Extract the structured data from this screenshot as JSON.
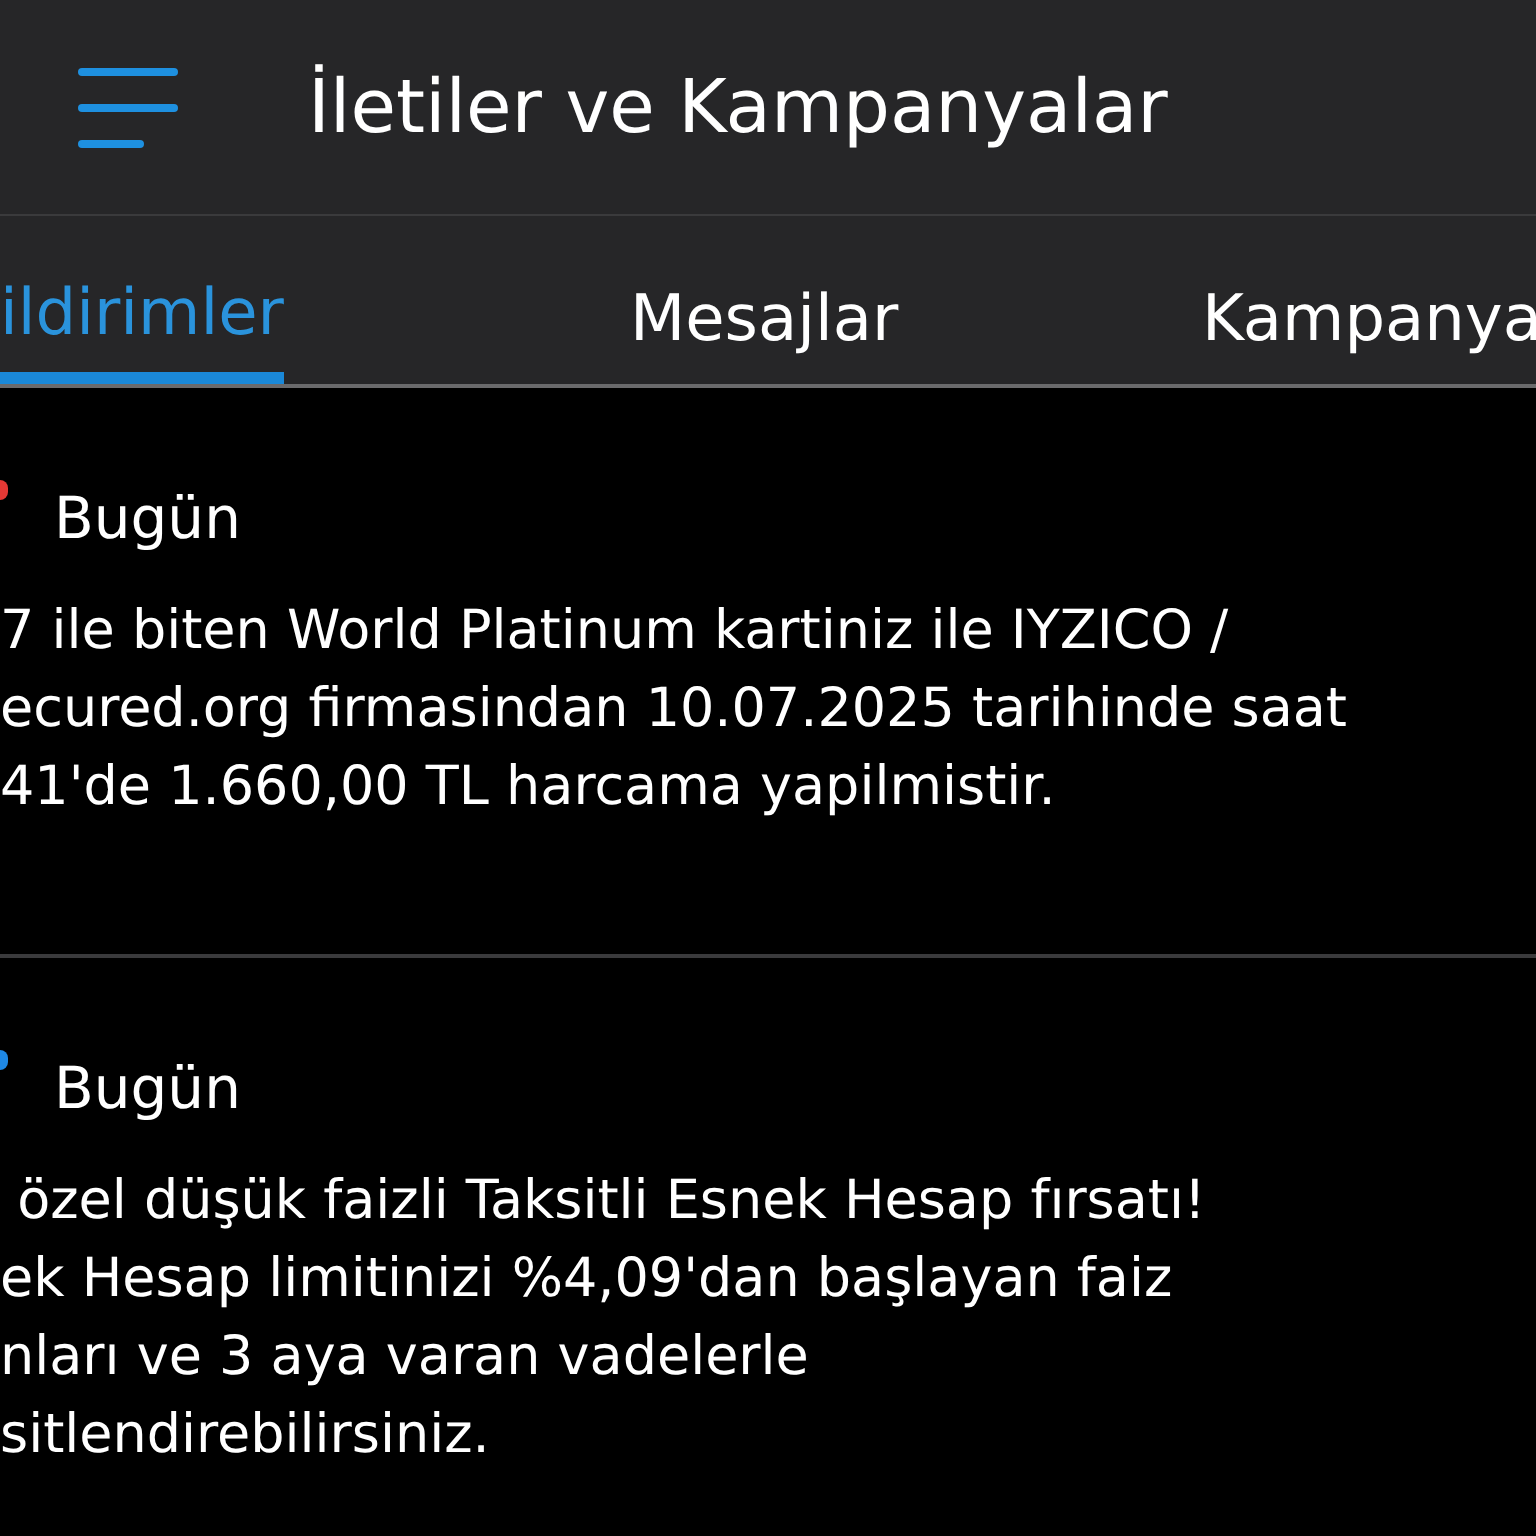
{
  "header": {
    "title": "İletiler ve Kampanyalar"
  },
  "tabs": [
    {
      "label": "ildirimler",
      "selected": true
    },
    {
      "label": "Mesajlar",
      "selected": false
    },
    {
      "label": "Kampanya",
      "selected": false
    }
  ],
  "messages": [
    {
      "color": "#e53935",
      "date": "Bugün",
      "lines": [
        "7 ile biten World Platinum kartiniz ile IYZICO /",
        "ecured.org firmasindan 10.07.2025 tarihinde saat",
        "41'de 1.660,00 TL harcama yapilmistir."
      ]
    },
    {
      "color": "#1e88e5",
      "date": "Bugün",
      "lines": [
        " özel düşük faizli Taksitli Esnek Hesap fırsatı!",
        "ek Hesap limitinizi %4,09'dan başlayan faiz",
        "nları ve 3 aya varan vadelerle",
        "sitlendirebilirsiniz."
      ]
    }
  ]
}
